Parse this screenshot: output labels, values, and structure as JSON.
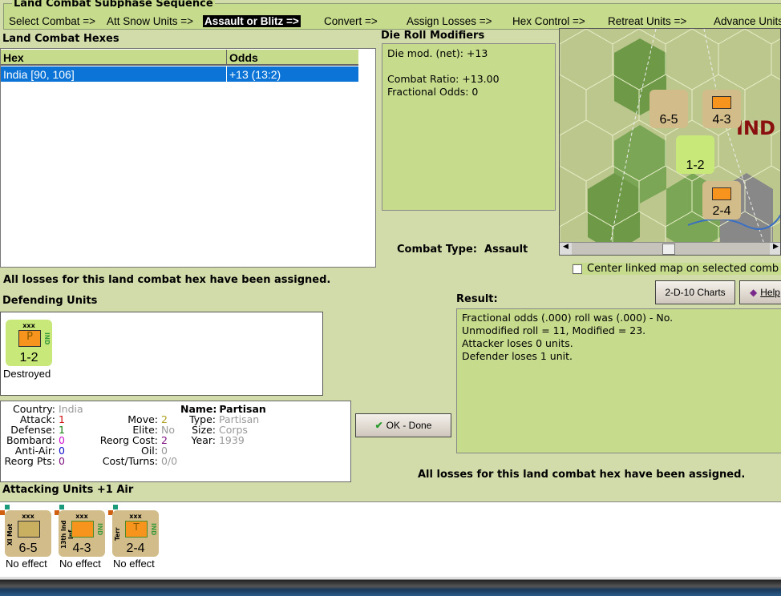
{
  "sequence": {
    "title": "Land Combat Subphase Sequence",
    "items": [
      "Select Combat =>",
      "Att Snow Units =>",
      "Assault or Blitz =>",
      "Convert =>",
      "Assign Losses =>",
      "Hex Control =>",
      "Retreat Units =>",
      "Advance Units"
    ],
    "active_index": 2
  },
  "hexes": {
    "title": "Land Combat Hexes",
    "columns": [
      "Hex",
      "Odds"
    ],
    "rows": [
      {
        "hex": "India [90, 106]",
        "odds": "+13 (13:2)"
      }
    ]
  },
  "drm": {
    "title": "Die Roll Modifiers",
    "lines": [
      "Die mod. (net): +13",
      "",
      "Combat Ratio: +13.00",
      "Fractional Odds: 0"
    ]
  },
  "combat_type": {
    "label": "Combat Type:",
    "value": "Assault"
  },
  "center_map": {
    "label": "Center linked map on selected comb",
    "checked": false
  },
  "buttons": {
    "charts": "2-D-10 Charts",
    "help": "Help",
    "ok": "OK - Done"
  },
  "status_top": "All losses for this land combat hex have been assigned.",
  "status_bottom": "All losses for this land combat hex have been assigned.",
  "defending": {
    "title": "Defending Units",
    "units": [
      {
        "size": "xxx",
        "symbol": "P",
        "nation": "IND",
        "value": "1-2",
        "result": "Destroyed"
      }
    ]
  },
  "result": {
    "title": "Result:",
    "lines": [
      "Fractional odds (.000) roll was (.000)  - No.",
      "Unmodified roll = 11, Modified = 23.",
      "Attacker loses 0 units.",
      "Defender loses 1 unit."
    ]
  },
  "info": {
    "country_k": "Country:",
    "country": "India",
    "attack_k": "Attack:",
    "attack": "1",
    "defense_k": "Defense:",
    "defense": "1",
    "bombard_k": "Bombard:",
    "bombard": "0",
    "antiair_k": "Anti-Air:",
    "antiair": "0",
    "reorgpts_k": "Reorg Pts:",
    "reorgpts": "0",
    "move_k": "Move:",
    "move": "2",
    "elite_k": "Elite:",
    "elite": "No",
    "reorgcost_k": "Reorg Cost:",
    "reorgcost": "2",
    "oil_k": "Oil:",
    "oil": "0",
    "cost_k": "Cost/Turns:",
    "cost": "0/0",
    "name_k": "Name:",
    "name": "Partisan",
    "type_k": "Type:",
    "type": "Partisan",
    "size_k": "Size:",
    "size": "Corps",
    "year_k": "Year:",
    "year": "1939"
  },
  "attacking": {
    "title": "Attacking Units +1 Air",
    "units": [
      {
        "side": "XI Mot",
        "size": "xxx",
        "value": "6-5",
        "result": "No effect"
      },
      {
        "side": "13th Ind Inf",
        "size": "xxx",
        "nation": "IND",
        "value": "4-3",
        "result": "No effect"
      },
      {
        "side": "Terr",
        "size": "xxx",
        "symbol": "T",
        "nation": "IND",
        "value": "2-4",
        "result": "No effect"
      }
    ]
  },
  "map": {
    "label": "IND",
    "counters": [
      "6-5",
      "4-3",
      "1-2",
      "2-4"
    ]
  },
  "colors": {
    "panel": "#c6db8c",
    "selected": "#0b74d6",
    "counter_tan": "#d2bc8a",
    "counter_green": "#c8e87a",
    "orange": "#f7941d"
  }
}
